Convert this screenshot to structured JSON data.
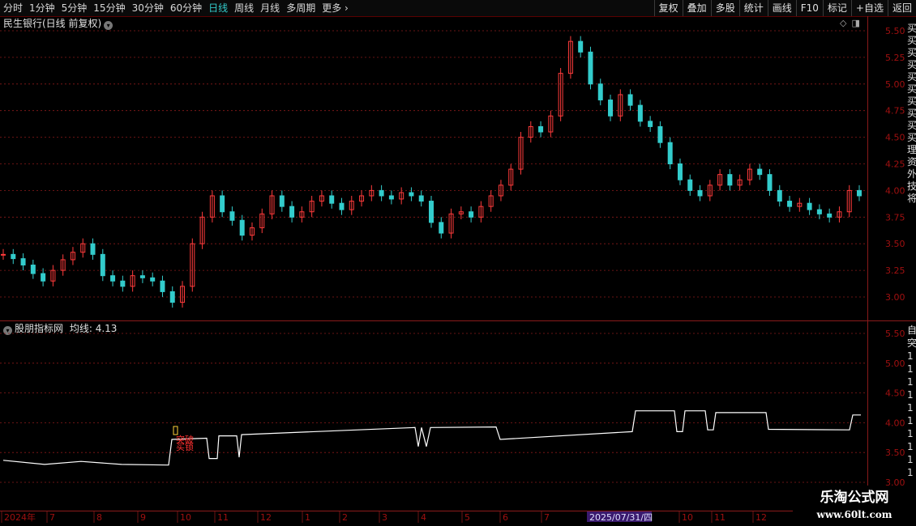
{
  "toolbar": {
    "periods": [
      "分时",
      "1分钟",
      "5分钟",
      "15分钟",
      "30分钟",
      "60分钟",
      "日线",
      "周线",
      "月线",
      "多周期",
      "更多"
    ],
    "active_period": "日线",
    "buttons": [
      "复权",
      "叠加",
      "多股",
      "统计",
      "画线",
      "F10",
      "标记",
      "+自选",
      "返回"
    ]
  },
  "main_chart": {
    "title": "民生银行(日线 前复权)",
    "y_ticks": [
      "5.50",
      "5.25",
      "5.00",
      "4.75",
      "4.50",
      "4.25",
      "4.00",
      "3.75",
      "3.50",
      "3.25",
      "3.00"
    ]
  },
  "indicator": {
    "title": "股朋指标网",
    "ma_label": "均线:",
    "ma_value": "4.13",
    "y_ticks": [
      "5.50",
      "5.00",
      "4.50",
      "4.00",
      "3.50",
      "3.00"
    ],
    "annotation": "突破",
    "annotation2": "买锁"
  },
  "x_axis": {
    "labels": [
      "2024年",
      "7",
      "8",
      "9",
      "10",
      "11",
      "12",
      "1",
      "2",
      "3",
      "4",
      "5",
      "6",
      "7",
      "10",
      "11",
      "12"
    ],
    "highlight": "2025/07/31/四"
  },
  "side_text": {
    "top": "买买买买买买买买买买理资外技将",
    "bottom": "自突1111111111"
  },
  "watermark": {
    "brand": "乐淘公式网",
    "url": "www.60lt.com"
  },
  "colors": {
    "up": "#ff3b3b",
    "down": "#33cccc",
    "grid": "#8a1a1a",
    "axis_text": "#a01010",
    "indicator_line": "#ffffff"
  },
  "chart_data": {
    "type": "candlestick",
    "series": [
      {
        "values": [
          3.4,
          3.36,
          3.3,
          3.22,
          3.15,
          3.25,
          3.35,
          3.42,
          3.5,
          3.4,
          3.2,
          3.15,
          3.1,
          3.2,
          3.18,
          3.15,
          3.05,
          2.95,
          3.1,
          3.5,
          3.75,
          3.95,
          3.8,
          3.72,
          3.58,
          3.65,
          3.78,
          3.95,
          3.85,
          3.75,
          3.8,
          3.9,
          3.95,
          3.88,
          3.82,
          3.9,
          3.95,
          4.0,
          3.95,
          3.92,
          3.98,
          3.95,
          3.9,
          3.7,
          3.6,
          3.78,
          3.8,
          3.75,
          3.85,
          3.95,
          4.05,
          4.2,
          4.5,
          4.6,
          4.55,
          4.7,
          5.1,
          5.4,
          5.3,
          5.0,
          4.85,
          4.7,
          4.9,
          4.8,
          4.65,
          4.6,
          4.45,
          4.25,
          4.1,
          4.0,
          3.95,
          4.05,
          4.15,
          4.05,
          4.1,
          4.2,
          4.15,
          4.0,
          3.9,
          3.85,
          3.88,
          3.82,
          3.78,
          3.75,
          3.8,
          4.0,
          3.95
        ]
      }
    ],
    "ylim": [
      2.9,
      5.55
    ]
  }
}
